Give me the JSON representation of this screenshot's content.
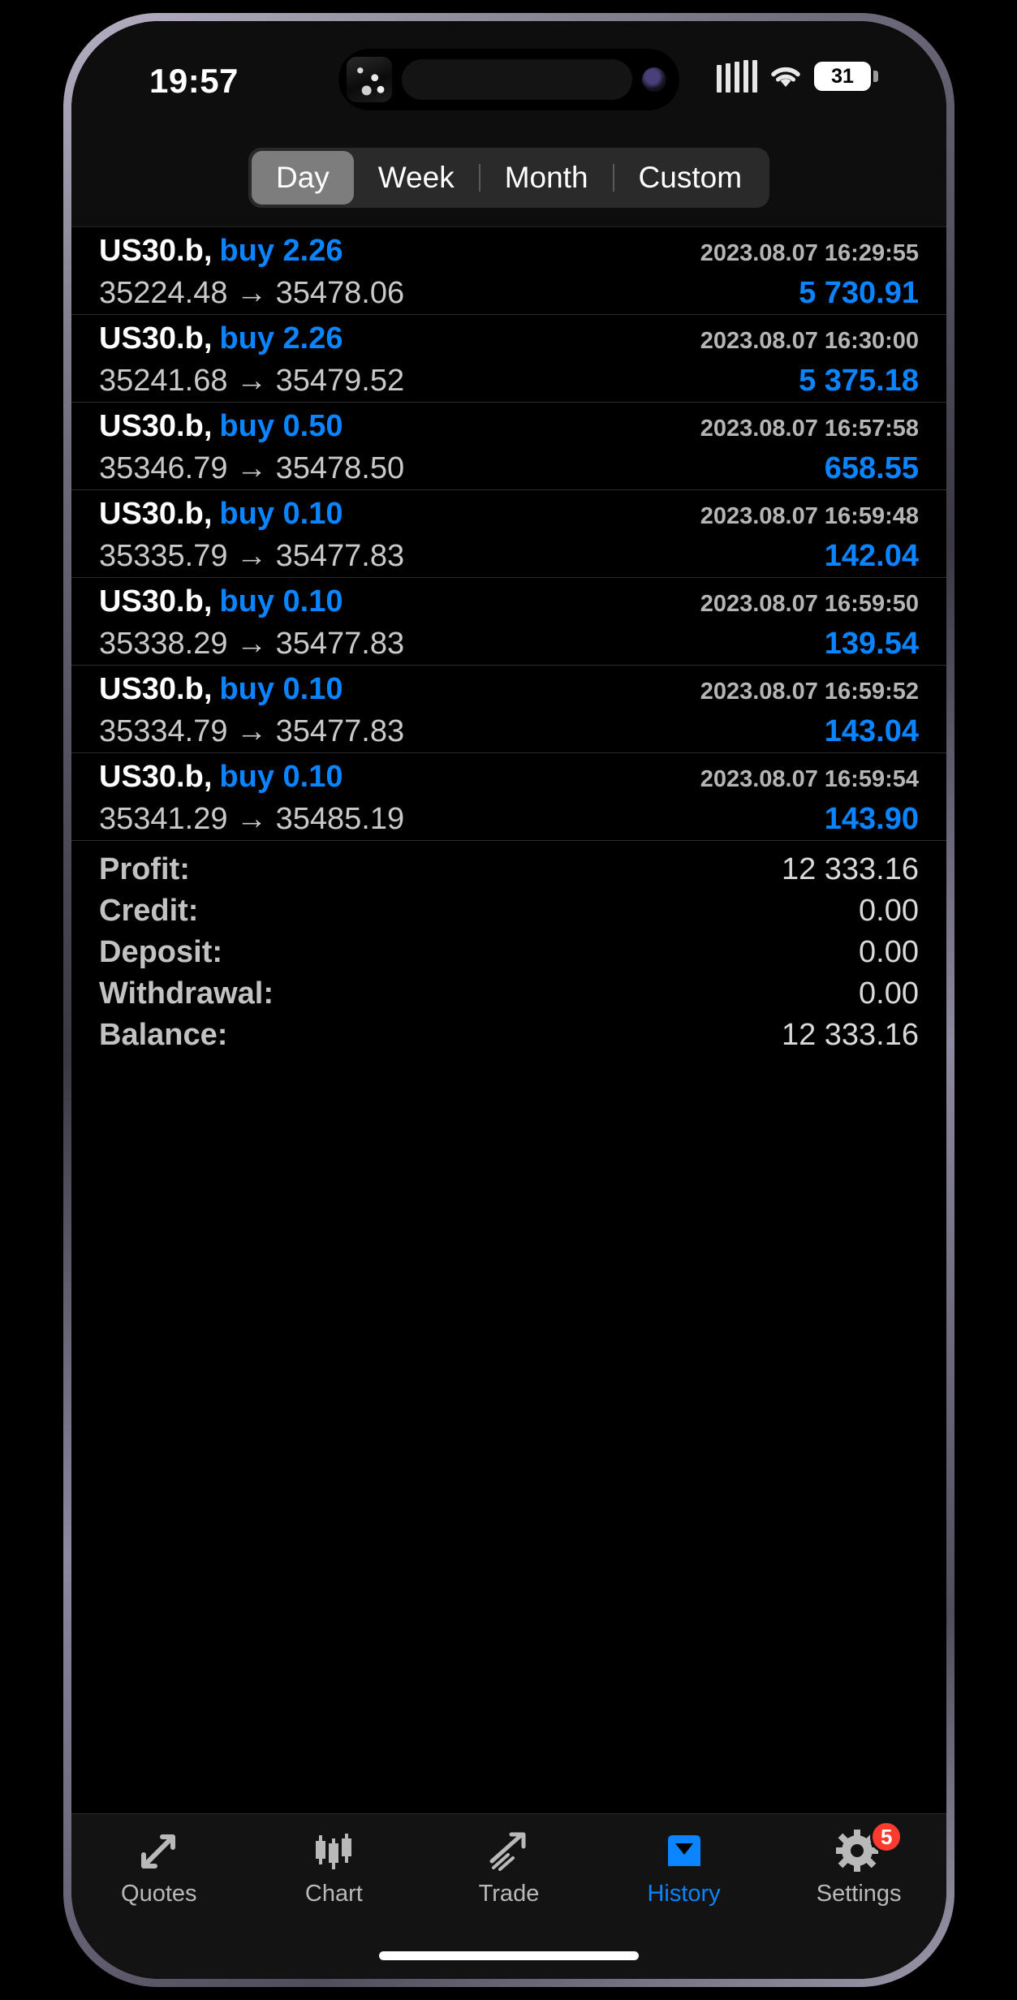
{
  "status_bar": {
    "time": "19:57",
    "battery_percent": "31",
    "icons": {
      "signal": "cellular-signal-icon",
      "wifi": "wifi-icon",
      "battery": "battery-icon",
      "island_thumb": "live-activity-thumbnail",
      "island_camera": "front-camera-icon"
    }
  },
  "period_filter": {
    "options": [
      "Day",
      "Week",
      "Month",
      "Custom"
    ],
    "selected": "Day"
  },
  "deals": {
    "columns": [
      "symbol",
      "side",
      "volume",
      "time",
      "open_price",
      "close_price",
      "profit"
    ],
    "rows": [
      {
        "symbol": "US30.b,",
        "side": "buy",
        "volume": "2.26",
        "time": "2023.08.07 16:29:55",
        "open_price": "35224.48",
        "close_price": "35478.06",
        "prices": "35224.48 → 35478.06",
        "profit": "5 730.91"
      },
      {
        "symbol": "US30.b,",
        "side": "buy",
        "volume": "2.26",
        "time": "2023.08.07 16:30:00",
        "open_price": "35241.68",
        "close_price": "35479.52",
        "prices": "35241.68 → 35479.52",
        "profit": "5 375.18"
      },
      {
        "symbol": "US30.b,",
        "side": "buy",
        "volume": "0.50",
        "time": "2023.08.07 16:57:58",
        "open_price": "35346.79",
        "close_price": "35478.50",
        "prices": "35346.79 → 35478.50",
        "profit": "658.55"
      },
      {
        "symbol": "US30.b,",
        "side": "buy",
        "volume": "0.10",
        "time": "2023.08.07 16:59:48",
        "open_price": "35335.79",
        "close_price": "35477.83",
        "prices": "35335.79 → 35477.83",
        "profit": "142.04"
      },
      {
        "symbol": "US30.b,",
        "side": "buy",
        "volume": "0.10",
        "time": "2023.08.07 16:59:50",
        "open_price": "35338.29",
        "close_price": "35477.83",
        "prices": "35338.29 → 35477.83",
        "profit": "139.54"
      },
      {
        "symbol": "US30.b,",
        "side": "buy",
        "volume": "0.10",
        "time": "2023.08.07 16:59:52",
        "open_price": "35334.79",
        "close_price": "35477.83",
        "prices": "35334.79 → 35477.83",
        "profit": "143.04"
      },
      {
        "symbol": "US30.b,",
        "side": "buy",
        "volume": "0.10",
        "time": "2023.08.07 16:59:54",
        "open_price": "35341.29",
        "close_price": "35485.19",
        "prices": "35341.29 → 35485.19",
        "profit": "143.90"
      }
    ]
  },
  "summary": [
    {
      "label": "Profit:",
      "value": "12 333.16"
    },
    {
      "label": "Credit:",
      "value": "0.00"
    },
    {
      "label": "Deposit:",
      "value": "0.00"
    },
    {
      "label": "Withdrawal:",
      "value": "0.00"
    },
    {
      "label": "Balance:",
      "value": "12 333.16"
    }
  ],
  "tab_bar": {
    "items": [
      {
        "label": "Quotes",
        "icon": "two-way-arrows-icon",
        "active": false,
        "badge": ""
      },
      {
        "label": "Chart",
        "icon": "candlestick-icon",
        "active": false,
        "badge": ""
      },
      {
        "label": "Trade",
        "icon": "trend-up-arrow-icon",
        "active": false,
        "badge": ""
      },
      {
        "label": "History",
        "icon": "archive-box-icon",
        "active": true,
        "badge": ""
      },
      {
        "label": "Settings",
        "icon": "gear-icon",
        "active": false,
        "badge": "5"
      }
    ]
  },
  "colors": {
    "accent_blue": "#0a84ff",
    "badge_red": "#ff3b30",
    "screen_bg": "#000000",
    "chrome_bg": "#0e0e0e",
    "separator": "#2b2b2b"
  }
}
